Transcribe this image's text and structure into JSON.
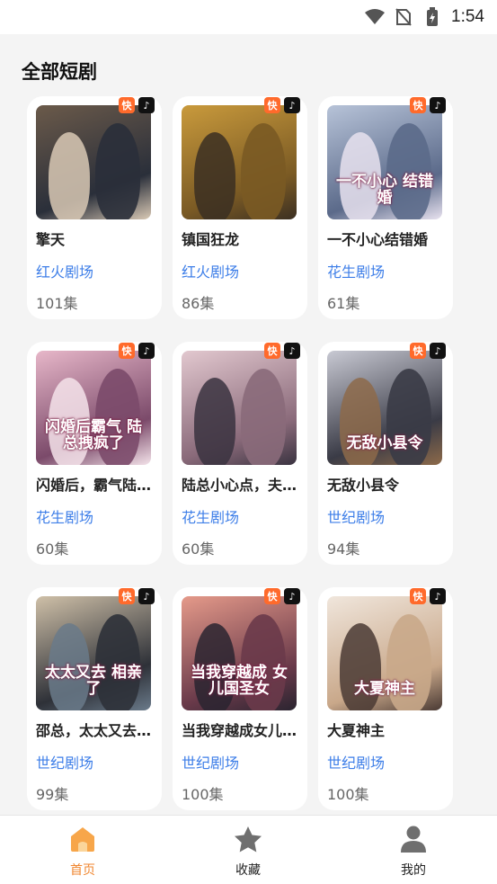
{
  "status_bar": {
    "time": "1:54"
  },
  "page": {
    "title": "全部短剧"
  },
  "badges": {
    "kuaishou": "快",
    "douyin": "♪"
  },
  "dramas": [
    {
      "title": "擎天",
      "source": "红火剧场",
      "episodes": "101集",
      "caption": "",
      "palette": [
        "#2a2f3a",
        "#6b5a4a",
        "#d9c9b5"
      ]
    },
    {
      "title": "镇国狂龙",
      "source": "红火剧场",
      "episodes": "86集",
      "caption": "",
      "palette": [
        "#7a5a24",
        "#c99a3c",
        "#3b2f22"
      ]
    },
    {
      "title": "一不小心结错婚",
      "source": "花生剧场",
      "episodes": "61集",
      "caption": "一不小心 结错婚",
      "palette": [
        "#5b6a8a",
        "#b7c3d8",
        "#e8e2ef"
      ]
    },
    {
      "title": "闪婚后，霸气陆总拽疯了",
      "source": "花生剧场",
      "episodes": "60集",
      "caption": "闪婚后霸气 陆总拽疯了",
      "palette": [
        "#7b4a6a",
        "#e7b7c9",
        "#f4e3ea"
      ]
    },
    {
      "title": "陆总小心点，夫人她又要跑了",
      "source": "花生剧场",
      "episodes": "60集",
      "caption": "",
      "palette": [
        "#8a6a7a",
        "#e2c8cf",
        "#3a3340"
      ]
    },
    {
      "title": "无敌小县令",
      "source": "世纪剧场",
      "episodes": "94集",
      "caption": "无敌小县令",
      "palette": [
        "#3a3b46",
        "#c8c9d3",
        "#8d6a4a"
      ]
    },
    {
      "title": "邵总，太太又去相亲了",
      "source": "世纪剧场",
      "episodes": "99集",
      "caption": "太太又去 相亲了",
      "palette": [
        "#2e3138",
        "#cfc0a8",
        "#6a7a8a"
      ]
    },
    {
      "title": "当我穿越成女儿国圣女",
      "source": "世纪剧场",
      "episodes": "100集",
      "caption": "当我穿越成 女儿国圣女",
      "palette": [
        "#6a3a4a",
        "#e59a8a",
        "#2a2430"
      ]
    },
    {
      "title": "大夏神主",
      "source": "世纪剧场",
      "episodes": "100集",
      "caption": "大夏神主",
      "palette": [
        "#c9a88a",
        "#f0e6dc",
        "#4a3a34"
      ]
    }
  ],
  "tabbar": [
    {
      "label": "首页",
      "icon": "home-icon",
      "active": true
    },
    {
      "label": "收藏",
      "icon": "star-icon",
      "active": false
    },
    {
      "label": "我的",
      "icon": "profile-icon",
      "active": false
    }
  ],
  "colors": {
    "accent": "#f0862f",
    "link": "#3d7ee8"
  }
}
